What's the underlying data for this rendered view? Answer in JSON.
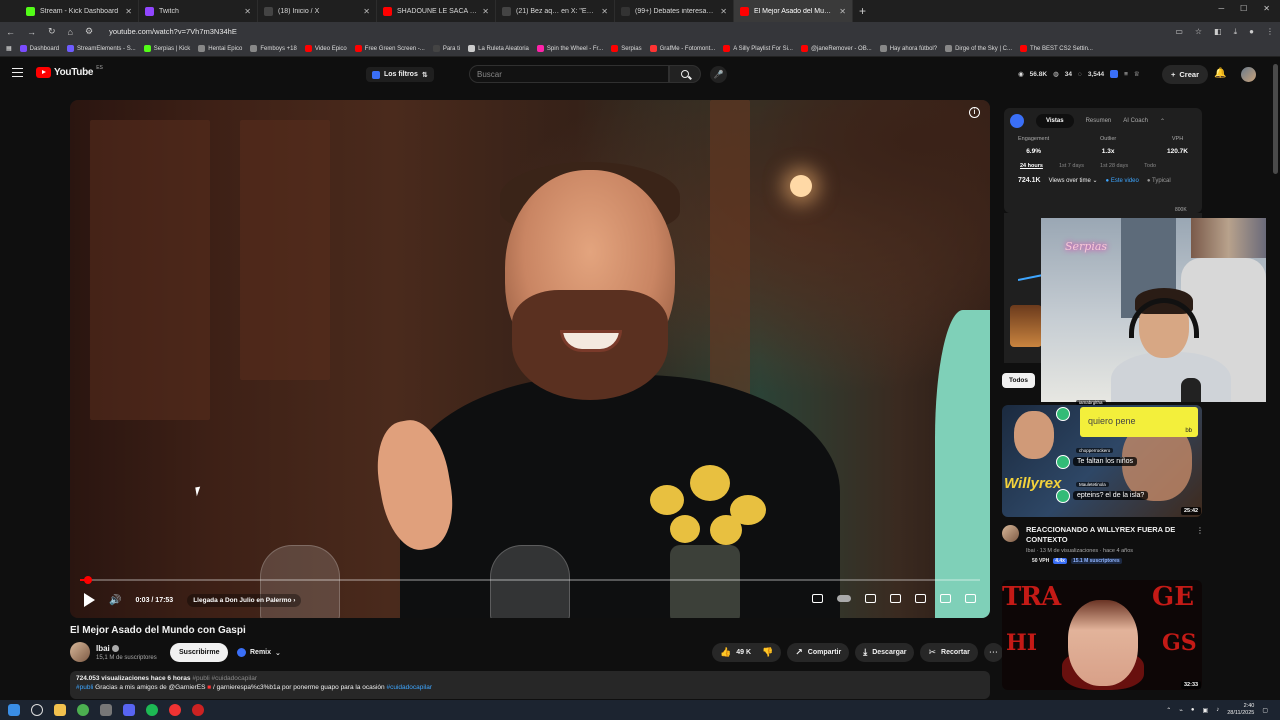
{
  "browser": {
    "tabs": [
      {
        "label": "Stream - Kick Dashboard",
        "color": "#53fc18"
      },
      {
        "label": "Twitch",
        "color": "#9146ff"
      },
      {
        "label": "(18) Inicio / X",
        "color": "#444"
      },
      {
        "label": "SHADOUNE LE SACA a XOKAS",
        "color": "#ff0000"
      },
      {
        "label": "(21) Bez aq… en X: \"Estab",
        "color": "#444"
      },
      {
        "label": "(99+) Debates interesantes con",
        "color": "#333"
      },
      {
        "label": "El Mejor Asado del Mundo con",
        "color": "#ff0000"
      }
    ],
    "url": "youtube.com/watch?v=7Vh7m3N34hE",
    "bookmarks": [
      {
        "label": "Dashboard",
        "color": "#7b4cff"
      },
      {
        "label": "StreamElements - S...",
        "color": "#6e5cff"
      },
      {
        "label": "Serpias | Kick",
        "color": "#53fc18"
      },
      {
        "label": "Hentai Epico",
        "color": "#888"
      },
      {
        "label": "Femboys +18",
        "color": "#888"
      },
      {
        "label": "Video Epico",
        "color": "#ff0000"
      },
      {
        "label": "Free Green Screen -...",
        "color": "#ff0000"
      },
      {
        "label": "Para ti",
        "color": "#444"
      },
      {
        "label": "La Ruleta Aleatoria",
        "color": "#ccc"
      },
      {
        "label": "Spin the Wheel - Fr...",
        "color": "#f2a"
      },
      {
        "label": "Serpias",
        "color": "#ff0000"
      },
      {
        "label": "GrafMe - Fotomont...",
        "color": "#ff3333"
      },
      {
        "label": "A Silly Playlist For Si...",
        "color": "#ff0000"
      },
      {
        "label": "@janeRemover - OB...",
        "color": "#ff0000"
      },
      {
        "label": "Hay ahora fútbol?",
        "color": "#888"
      },
      {
        "label": "Dirge of the Sky | C...",
        "color": "#888"
      },
      {
        "label": "The BEST CS2 Settin...",
        "color": "#ff0000"
      }
    ]
  },
  "header": {
    "logo_text": "YouTube",
    "country_code": "ES",
    "filters_label": "Los filtros",
    "search_placeholder": "Buscar",
    "stat_views": "56.8K",
    "stat_a": "34",
    "stat_b": "3,544",
    "create_label": "Crear"
  },
  "player": {
    "time": "0:03 / 17:53",
    "chapter": "Llegada a Don Julio en Palermo",
    "progress_fraction": 0.003
  },
  "video": {
    "title": "El Mejor Asado del Mundo con Gaspi",
    "channel": "Ibai",
    "subscribers": "15,1 M de suscriptores",
    "subscribe_label": "Suscribirme",
    "remix_label": "Remix",
    "likes": "49 K",
    "share_label": "Compartir",
    "download_label": "Descargar",
    "clip_label": "Recortar",
    "views_line": "724.053 visualizaciones  hace 6 horas",
    "hashtags_line": "#publi #cuidadocapilar",
    "desc_publi": "#publi",
    "desc_text": " Gracias  a mis amigos de @GarnierES  ",
    "desc_link2": "/ garnierespa%c3%b1a",
    "desc_text2": "  por ponerme guapo para la ocasión ",
    "desc_tag": "#cuidadocapilar"
  },
  "analytics": {
    "tabs": [
      "Vistas",
      "Resumen",
      "AI Coach"
    ],
    "metrics": [
      {
        "label": "Engagement",
        "value": "6.9%"
      },
      {
        "label": "Outlier",
        "value": "1.3x"
      },
      {
        "label": "VPH",
        "value": "120.7K"
      }
    ],
    "ranges": [
      "24 hours",
      "1st 7 days",
      "1st 28 days",
      "Todo"
    ],
    "total": "724.1K",
    "dropdown": "Views over time",
    "legend_this": "Este video",
    "legend_typical": "Typical",
    "ymax": "800K"
  },
  "sidebar": {
    "chip": "Todos",
    "video1": {
      "title": "REACCIONANDO A WILLYREX FUERA DE CONTEXTO",
      "channel": "Ibai",
      "meta": "Ibai · 13 M de visualizaciones · hace 4 años",
      "tag1": "50 VPH",
      "tag2": "4.4x",
      "tag3": "15.1 M suscriptores",
      "duration": "25:42",
      "brand_text": "Willyrex",
      "chat": [
        {
          "user": "iamabrgltha",
          "text": "quiero pene",
          "bb": "bb"
        },
        {
          "user": "chopperrockero",
          "text": "Te faltan los niños"
        },
        {
          "user": "Mauletetinola",
          "text": "epteins? el de la isla?"
        }
      ]
    },
    "video2": {
      "duration": "32:33",
      "thumb_text_a": "TRA",
      "thumb_text_b": "GE",
      "thumb_text_c": "HI",
      "thumb_text_d": "GS"
    }
  },
  "webcam": {
    "neon_text": "Serpias"
  },
  "taskbar": {
    "time": "2:40",
    "date": "28/11/2025"
  }
}
